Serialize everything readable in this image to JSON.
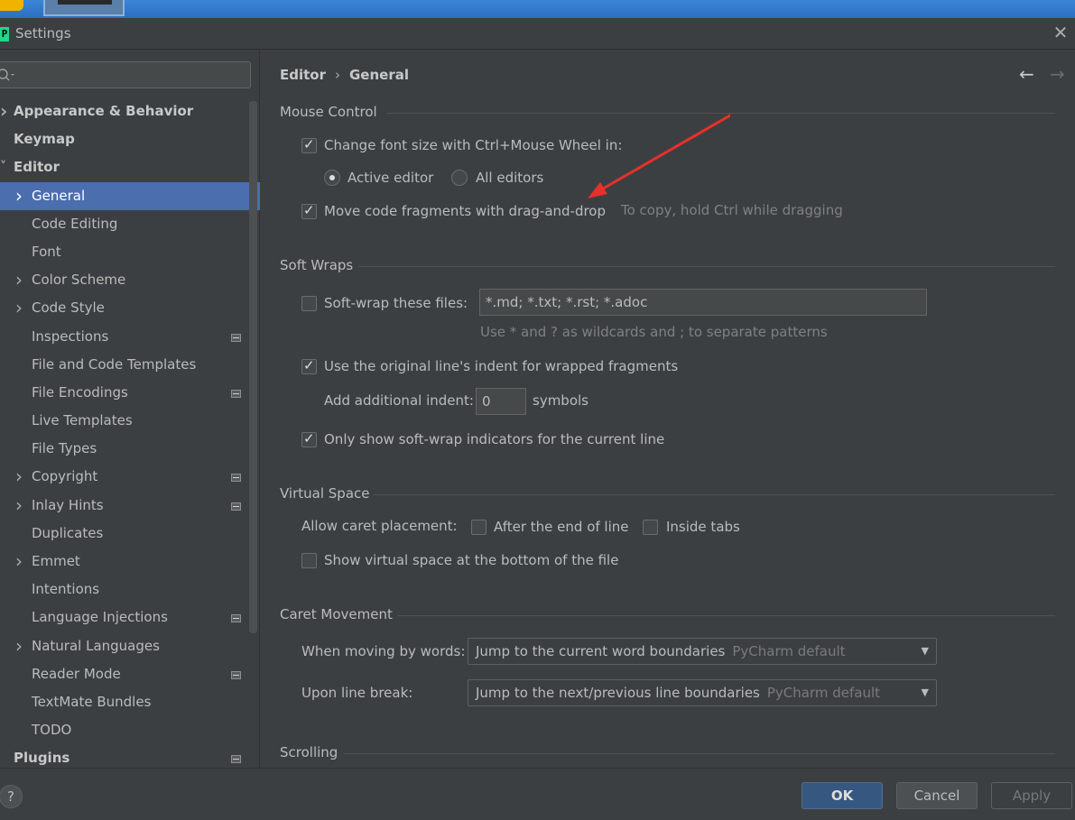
{
  "window": {
    "title": "Settings",
    "app_icon_glyph": "P"
  },
  "search": {
    "value": "",
    "placeholder": ""
  },
  "tree": [
    {
      "label": "Appearance & Behavior",
      "level": 0,
      "chevron": true,
      "badge": false,
      "selected": false
    },
    {
      "label": "Keymap",
      "level": 0,
      "chevron": false,
      "badge": false,
      "selected": false
    },
    {
      "label": "Editor",
      "level": 0,
      "chevron": "open",
      "badge": false,
      "selected": false
    },
    {
      "label": "General",
      "level": 1,
      "chevron": true,
      "badge": false,
      "selected": true
    },
    {
      "label": "Code Editing",
      "level": 1,
      "chevron": false,
      "badge": false,
      "selected": false
    },
    {
      "label": "Font",
      "level": 1,
      "chevron": false,
      "badge": false,
      "selected": false
    },
    {
      "label": "Color Scheme",
      "level": 1,
      "chevron": true,
      "badge": false,
      "selected": false
    },
    {
      "label": "Code Style",
      "level": 1,
      "chevron": true,
      "badge": false,
      "selected": false
    },
    {
      "label": "Inspections",
      "level": 1,
      "chevron": false,
      "badge": true,
      "selected": false
    },
    {
      "label": "File and Code Templates",
      "level": 1,
      "chevron": false,
      "badge": false,
      "selected": false
    },
    {
      "label": "File Encodings",
      "level": 1,
      "chevron": false,
      "badge": true,
      "selected": false
    },
    {
      "label": "Live Templates",
      "level": 1,
      "chevron": false,
      "badge": false,
      "selected": false
    },
    {
      "label": "File Types",
      "level": 1,
      "chevron": false,
      "badge": false,
      "selected": false
    },
    {
      "label": "Copyright",
      "level": 1,
      "chevron": true,
      "badge": true,
      "selected": false
    },
    {
      "label": "Inlay Hints",
      "level": 1,
      "chevron": true,
      "badge": true,
      "selected": false
    },
    {
      "label": "Duplicates",
      "level": 1,
      "chevron": false,
      "badge": false,
      "selected": false
    },
    {
      "label": "Emmet",
      "level": 1,
      "chevron": true,
      "badge": false,
      "selected": false
    },
    {
      "label": "Intentions",
      "level": 1,
      "chevron": false,
      "badge": false,
      "selected": false
    },
    {
      "label": "Language Injections",
      "level": 1,
      "chevron": false,
      "badge": true,
      "selected": false
    },
    {
      "label": "Natural Languages",
      "level": 1,
      "chevron": true,
      "badge": false,
      "selected": false
    },
    {
      "label": "Reader Mode",
      "level": 1,
      "chevron": false,
      "badge": true,
      "selected": false
    },
    {
      "label": "TextMate Bundles",
      "level": 1,
      "chevron": false,
      "badge": false,
      "selected": false
    },
    {
      "label": "TODO",
      "level": 1,
      "chevron": false,
      "badge": false,
      "selected": false
    },
    {
      "label": "Plugins",
      "level": 0,
      "chevron": false,
      "badge": true,
      "selected": false
    }
  ],
  "breadcrumb": {
    "parent": "Editor",
    "separator": "›",
    "current": "General"
  },
  "nav": {
    "back_icon": "←",
    "forward_icon": "→"
  },
  "mouse_control": {
    "title": "Mouse Control",
    "change_font_size": {
      "label": "Change font size with Ctrl+Mouse Wheel in:",
      "checked": true
    },
    "active_editor": {
      "label": "Active editor",
      "checked": true
    },
    "all_editors": {
      "label": "All editors",
      "checked": false
    },
    "move_fragments": {
      "label": "Move code fragments with drag-and-drop",
      "checked": true
    },
    "move_hint": "To copy, hold Ctrl while dragging"
  },
  "soft_wraps": {
    "title": "Soft Wraps",
    "soft_wrap_files": {
      "label": "Soft-wrap these files:",
      "checked": false
    },
    "patterns_value": "*.md; *.txt; *.rst; *.adoc",
    "patterns_hint": "Use * and ? as wildcards and ; to separate patterns",
    "original_indent": {
      "label": "Use the original line's indent for wrapped fragments",
      "checked": true
    },
    "additional_indent_label": "Add additional indent:",
    "additional_indent_value": "0",
    "symbols_label": "symbols",
    "only_show_indicators": {
      "label": "Only show soft-wrap indicators for the current line",
      "checked": true
    }
  },
  "virtual_space": {
    "title": "Virtual Space",
    "allow_caret_label": "Allow caret placement:",
    "after_end_of_line": {
      "label": "After the end of line",
      "checked": false
    },
    "inside_tabs": {
      "label": "Inside tabs",
      "checked": false
    },
    "show_virtual_space": {
      "label": "Show virtual space at the bottom of the file",
      "checked": false
    }
  },
  "caret_movement": {
    "title": "Caret Movement",
    "moving_by_words_label": "When moving by words:",
    "moving_by_words_value": "Jump to the current word boundaries",
    "moving_by_words_sub": "PyCharm default",
    "line_break_label": "Upon line break:",
    "line_break_value": "Jump to the next/previous line boundaries",
    "line_break_sub": "PyCharm default"
  },
  "scrolling": {
    "title": "Scrolling"
  },
  "buttons": {
    "help": "?",
    "ok": "OK",
    "cancel": "Cancel",
    "apply": "Apply"
  },
  "colors": {
    "selection": "#4b6eaf",
    "background": "#3c3f41",
    "ok_button": "#365880",
    "annotation_arrow": "#e8302a"
  }
}
